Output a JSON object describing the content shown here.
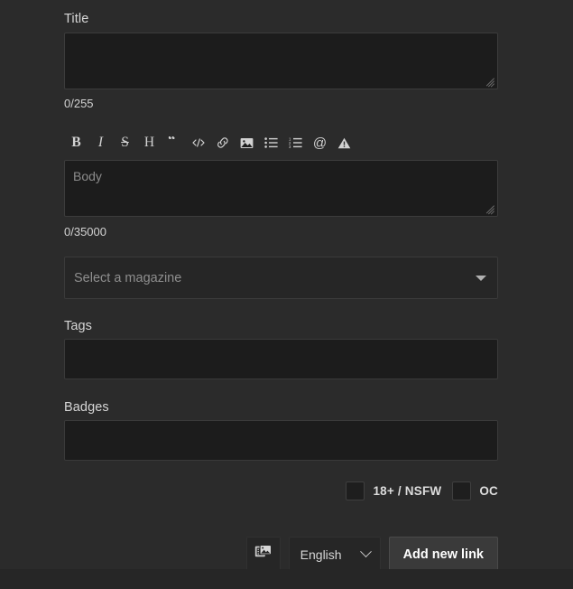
{
  "form": {
    "title": {
      "label": "Title",
      "value": "",
      "placeholder": "",
      "counter": "0/255"
    },
    "body": {
      "value": "",
      "placeholder": "Body",
      "counter": "0/35000"
    },
    "editor_toolbar": {
      "buttons": [
        {
          "name": "bold-icon",
          "glyph": "B",
          "title": "Bold"
        },
        {
          "name": "italic-icon",
          "glyph": "I",
          "title": "Italic"
        },
        {
          "name": "strikethrough-icon",
          "glyph": "S",
          "title": "Strikethrough"
        },
        {
          "name": "heading-icon",
          "glyph": "H",
          "title": "Heading"
        },
        {
          "name": "quote-icon",
          "glyph": "“",
          "title": "Quote"
        },
        {
          "name": "code-icon",
          "glyph": "</>",
          "title": "Code"
        },
        {
          "name": "link-icon",
          "glyph": "",
          "title": "Link"
        },
        {
          "name": "image-icon",
          "glyph": "",
          "title": "Image"
        },
        {
          "name": "bullet-list-icon",
          "glyph": "",
          "title": "Bulleted list"
        },
        {
          "name": "numbered-list-icon",
          "glyph": "",
          "title": "Numbered list"
        },
        {
          "name": "mention-icon",
          "glyph": "@",
          "title": "Mention"
        },
        {
          "name": "spoiler-icon",
          "glyph": "",
          "title": "Spoiler"
        }
      ]
    },
    "magazine": {
      "placeholder": "Select a magazine",
      "value": "",
      "icon": "triangle-down-icon"
    },
    "tags": {
      "label": "Tags",
      "value": "",
      "placeholder": ""
    },
    "badges": {
      "label": "Badges",
      "value": "",
      "placeholder": ""
    },
    "checkboxes": [
      {
        "name": "nsfw",
        "label": "18+ / NSFW",
        "checked": false
      },
      {
        "name": "oc",
        "label": "OC",
        "checked": false
      }
    ],
    "actions": {
      "gallery_button": {
        "icon": "gallery-images-icon",
        "label": ""
      },
      "language": {
        "value": "English",
        "icon": "chevron-down-icon"
      },
      "submit_label": "Add new link"
    }
  },
  "theme": {
    "page_background": "#2b2b2b",
    "footer_background": "#262626",
    "input_background": "#1c1c1c",
    "control_background": "#262626",
    "border": "#3a3a3a",
    "text": "#d6d6d6",
    "muted_text": "#8e8e8e",
    "submit_background": "#3a3a3a",
    "submit_text": "#ffffff"
  }
}
